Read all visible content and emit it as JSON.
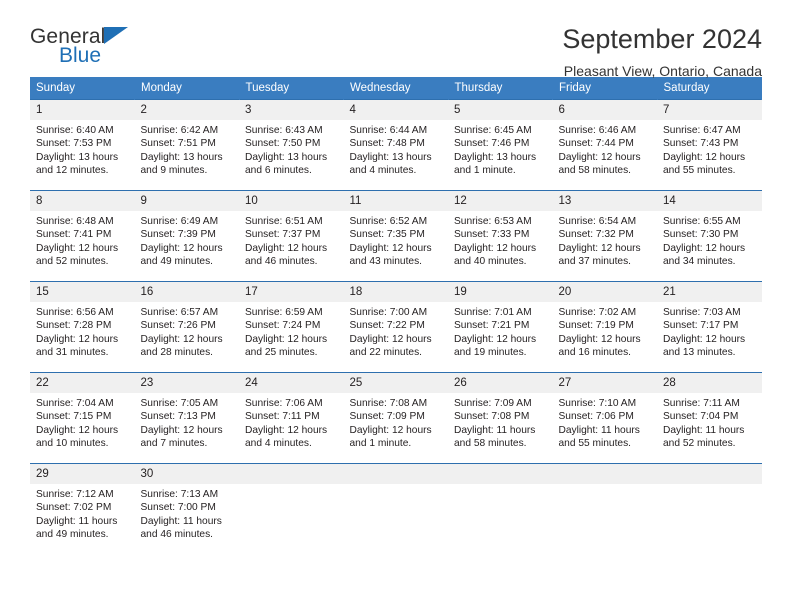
{
  "brand": {
    "name_part1": "General",
    "name_part2": "Blue",
    "accent_color": "#1f6fb5",
    "logo_icon": "triangle-icon"
  },
  "header": {
    "title": "September 2024",
    "subtitle": "Pleasant View, Ontario, Canada",
    "header_bg_color": "#3a7dc0",
    "daynum_bg_color": "#f0f0f0"
  },
  "weekday_headers": [
    "Sunday",
    "Monday",
    "Tuesday",
    "Wednesday",
    "Thursday",
    "Friday",
    "Saturday"
  ],
  "weeks": [
    [
      {
        "day": "1",
        "sunrise": "Sunrise: 6:40 AM",
        "sunset": "Sunset: 7:53 PM",
        "daylight_line1": "Daylight: 13 hours",
        "daylight_line2": "and 12 minutes."
      },
      {
        "day": "2",
        "sunrise": "Sunrise: 6:42 AM",
        "sunset": "Sunset: 7:51 PM",
        "daylight_line1": "Daylight: 13 hours",
        "daylight_line2": "and 9 minutes."
      },
      {
        "day": "3",
        "sunrise": "Sunrise: 6:43 AM",
        "sunset": "Sunset: 7:50 PM",
        "daylight_line1": "Daylight: 13 hours",
        "daylight_line2": "and 6 minutes."
      },
      {
        "day": "4",
        "sunrise": "Sunrise: 6:44 AM",
        "sunset": "Sunset: 7:48 PM",
        "daylight_line1": "Daylight: 13 hours",
        "daylight_line2": "and 4 minutes."
      },
      {
        "day": "5",
        "sunrise": "Sunrise: 6:45 AM",
        "sunset": "Sunset: 7:46 PM",
        "daylight_line1": "Daylight: 13 hours",
        "daylight_line2": "and 1 minute."
      },
      {
        "day": "6",
        "sunrise": "Sunrise: 6:46 AM",
        "sunset": "Sunset: 7:44 PM",
        "daylight_line1": "Daylight: 12 hours",
        "daylight_line2": "and 58 minutes."
      },
      {
        "day": "7",
        "sunrise": "Sunrise: 6:47 AM",
        "sunset": "Sunset: 7:43 PM",
        "daylight_line1": "Daylight: 12 hours",
        "daylight_line2": "and 55 minutes."
      }
    ],
    [
      {
        "day": "8",
        "sunrise": "Sunrise: 6:48 AM",
        "sunset": "Sunset: 7:41 PM",
        "daylight_line1": "Daylight: 12 hours",
        "daylight_line2": "and 52 minutes."
      },
      {
        "day": "9",
        "sunrise": "Sunrise: 6:49 AM",
        "sunset": "Sunset: 7:39 PM",
        "daylight_line1": "Daylight: 12 hours",
        "daylight_line2": "and 49 minutes."
      },
      {
        "day": "10",
        "sunrise": "Sunrise: 6:51 AM",
        "sunset": "Sunset: 7:37 PM",
        "daylight_line1": "Daylight: 12 hours",
        "daylight_line2": "and 46 minutes."
      },
      {
        "day": "11",
        "sunrise": "Sunrise: 6:52 AM",
        "sunset": "Sunset: 7:35 PM",
        "daylight_line1": "Daylight: 12 hours",
        "daylight_line2": "and 43 minutes."
      },
      {
        "day": "12",
        "sunrise": "Sunrise: 6:53 AM",
        "sunset": "Sunset: 7:33 PM",
        "daylight_line1": "Daylight: 12 hours",
        "daylight_line2": "and 40 minutes."
      },
      {
        "day": "13",
        "sunrise": "Sunrise: 6:54 AM",
        "sunset": "Sunset: 7:32 PM",
        "daylight_line1": "Daylight: 12 hours",
        "daylight_line2": "and 37 minutes."
      },
      {
        "day": "14",
        "sunrise": "Sunrise: 6:55 AM",
        "sunset": "Sunset: 7:30 PM",
        "daylight_line1": "Daylight: 12 hours",
        "daylight_line2": "and 34 minutes."
      }
    ],
    [
      {
        "day": "15",
        "sunrise": "Sunrise: 6:56 AM",
        "sunset": "Sunset: 7:28 PM",
        "daylight_line1": "Daylight: 12 hours",
        "daylight_line2": "and 31 minutes."
      },
      {
        "day": "16",
        "sunrise": "Sunrise: 6:57 AM",
        "sunset": "Sunset: 7:26 PM",
        "daylight_line1": "Daylight: 12 hours",
        "daylight_line2": "and 28 minutes."
      },
      {
        "day": "17",
        "sunrise": "Sunrise: 6:59 AM",
        "sunset": "Sunset: 7:24 PM",
        "daylight_line1": "Daylight: 12 hours",
        "daylight_line2": "and 25 minutes."
      },
      {
        "day": "18",
        "sunrise": "Sunrise: 7:00 AM",
        "sunset": "Sunset: 7:22 PM",
        "daylight_line1": "Daylight: 12 hours",
        "daylight_line2": "and 22 minutes."
      },
      {
        "day": "19",
        "sunrise": "Sunrise: 7:01 AM",
        "sunset": "Sunset: 7:21 PM",
        "daylight_line1": "Daylight: 12 hours",
        "daylight_line2": "and 19 minutes."
      },
      {
        "day": "20",
        "sunrise": "Sunrise: 7:02 AM",
        "sunset": "Sunset: 7:19 PM",
        "daylight_line1": "Daylight: 12 hours",
        "daylight_line2": "and 16 minutes."
      },
      {
        "day": "21",
        "sunrise": "Sunrise: 7:03 AM",
        "sunset": "Sunset: 7:17 PM",
        "daylight_line1": "Daylight: 12 hours",
        "daylight_line2": "and 13 minutes."
      }
    ],
    [
      {
        "day": "22",
        "sunrise": "Sunrise: 7:04 AM",
        "sunset": "Sunset: 7:15 PM",
        "daylight_line1": "Daylight: 12 hours",
        "daylight_line2": "and 10 minutes."
      },
      {
        "day": "23",
        "sunrise": "Sunrise: 7:05 AM",
        "sunset": "Sunset: 7:13 PM",
        "daylight_line1": "Daylight: 12 hours",
        "daylight_line2": "and 7 minutes."
      },
      {
        "day": "24",
        "sunrise": "Sunrise: 7:06 AM",
        "sunset": "Sunset: 7:11 PM",
        "daylight_line1": "Daylight: 12 hours",
        "daylight_line2": "and 4 minutes."
      },
      {
        "day": "25",
        "sunrise": "Sunrise: 7:08 AM",
        "sunset": "Sunset: 7:09 PM",
        "daylight_line1": "Daylight: 12 hours",
        "daylight_line2": "and 1 minute."
      },
      {
        "day": "26",
        "sunrise": "Sunrise: 7:09 AM",
        "sunset": "Sunset: 7:08 PM",
        "daylight_line1": "Daylight: 11 hours",
        "daylight_line2": "and 58 minutes."
      },
      {
        "day": "27",
        "sunrise": "Sunrise: 7:10 AM",
        "sunset": "Sunset: 7:06 PM",
        "daylight_line1": "Daylight: 11 hours",
        "daylight_line2": "and 55 minutes."
      },
      {
        "day": "28",
        "sunrise": "Sunrise: 7:11 AM",
        "sunset": "Sunset: 7:04 PM",
        "daylight_line1": "Daylight: 11 hours",
        "daylight_line2": "and 52 minutes."
      }
    ],
    [
      {
        "day": "29",
        "sunrise": "Sunrise: 7:12 AM",
        "sunset": "Sunset: 7:02 PM",
        "daylight_line1": "Daylight: 11 hours",
        "daylight_line2": "and 49 minutes."
      },
      {
        "day": "30",
        "sunrise": "Sunrise: 7:13 AM",
        "sunset": "Sunset: 7:00 PM",
        "daylight_line1": "Daylight: 11 hours",
        "daylight_line2": "and 46 minutes."
      },
      {
        "day": "",
        "sunrise": "",
        "sunset": "",
        "daylight_line1": "",
        "daylight_line2": ""
      },
      {
        "day": "",
        "sunrise": "",
        "sunset": "",
        "daylight_line1": "",
        "daylight_line2": ""
      },
      {
        "day": "",
        "sunrise": "",
        "sunset": "",
        "daylight_line1": "",
        "daylight_line2": ""
      },
      {
        "day": "",
        "sunrise": "",
        "sunset": "",
        "daylight_line1": "",
        "daylight_line2": ""
      },
      {
        "day": "",
        "sunrise": "",
        "sunset": "",
        "daylight_line1": "",
        "daylight_line2": ""
      }
    ]
  ]
}
